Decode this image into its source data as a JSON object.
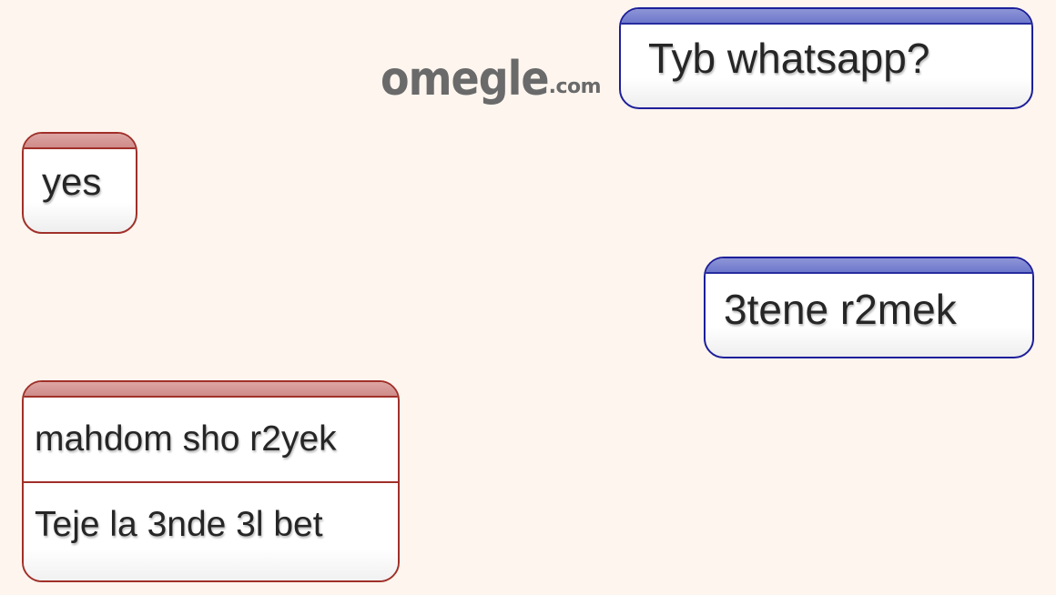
{
  "app": {
    "logo_main": "omegle",
    "logo_tld": ".com"
  },
  "messages": [
    {
      "sender": "you",
      "lines": [
        "Tyb whatsapp?"
      ]
    },
    {
      "sender": "stranger",
      "lines": [
        "yes"
      ]
    },
    {
      "sender": "you",
      "lines": [
        "3tene r2mek"
      ]
    },
    {
      "sender": "stranger",
      "lines": [
        "mahdom sho r2yek",
        "Teje la 3nde 3l bet"
      ]
    }
  ],
  "colors": {
    "background": "#fdf5ee",
    "you_border": "#1d1f9a",
    "you_cap": "#7c85d1",
    "stranger_border": "#a03029",
    "stranger_cap": "#d69996",
    "logo": "#6a6a6a"
  }
}
